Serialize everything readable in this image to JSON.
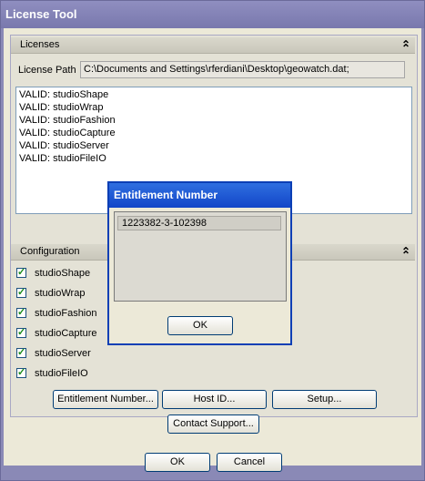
{
  "window": {
    "title": "License Tool"
  },
  "licenses": {
    "header": "Licenses",
    "collapse_icon": "double-chevron-up-icon",
    "path_label": "License Path",
    "path_value": "C:\\Documents and Settings\\rferdiani\\Desktop\\geowatch.dat;",
    "items": [
      "VALID: studioShape",
      "VALID: studioWrap",
      "VALID: studioFashion",
      "VALID: studioCapture",
      "VALID: studioServer",
      "VALID: studioFileIO"
    ]
  },
  "configuration": {
    "header": "Configuration",
    "items": [
      {
        "label": "studioShape",
        "checked": true
      },
      {
        "label": "studioWrap",
        "checked": true
      },
      {
        "label": "studioFashion",
        "checked": true
      },
      {
        "label": "studioCapture",
        "checked": true
      },
      {
        "label": "studioServer",
        "checked": true
      },
      {
        "label": "studioFileIO",
        "checked": true
      }
    ]
  },
  "buttons": {
    "entitlement": "Entitlement Number...",
    "host_id": "Host ID...",
    "setup": "Setup...",
    "contact": "Contact Support...",
    "ok": "OK",
    "cancel": "Cancel"
  },
  "dialog": {
    "title": "Entitlement Number",
    "value": "1223382-3-102398",
    "ok": "OK"
  }
}
